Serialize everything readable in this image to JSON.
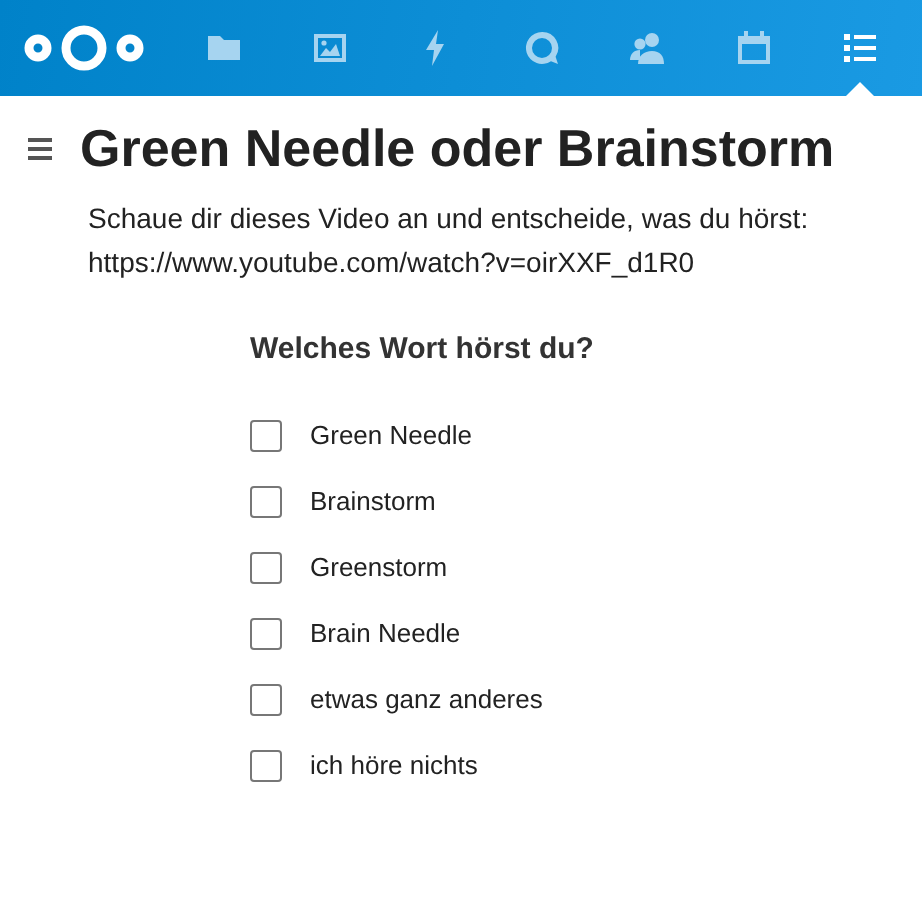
{
  "nav": [
    {
      "kind": "folder",
      "selected": false
    },
    {
      "kind": "image",
      "selected": false
    },
    {
      "kind": "bolt",
      "selected": false
    },
    {
      "kind": "bubble",
      "selected": false
    },
    {
      "kind": "contacts",
      "selected": false
    },
    {
      "kind": "calendar",
      "selected": false
    },
    {
      "kind": "list",
      "selected": true
    }
  ],
  "title": "Green Needle oder Brainstorm",
  "description": [
    "Schaue dir dieses Video an und entscheide, was du hörst:",
    "https://www.youtube.com/watch?v=oirXXF_d1R0"
  ],
  "question": {
    "title": "Welches Wort hörst du?",
    "options": [
      {
        "label": "Green Needle",
        "checked": false
      },
      {
        "label": "Brainstorm",
        "checked": false
      },
      {
        "label": "Greenstorm",
        "checked": false
      },
      {
        "label": "Brain Needle",
        "checked": false
      },
      {
        "label": "etwas ganz anderes",
        "checked": false
      },
      {
        "label": "ich höre nichts",
        "checked": false
      }
    ]
  }
}
